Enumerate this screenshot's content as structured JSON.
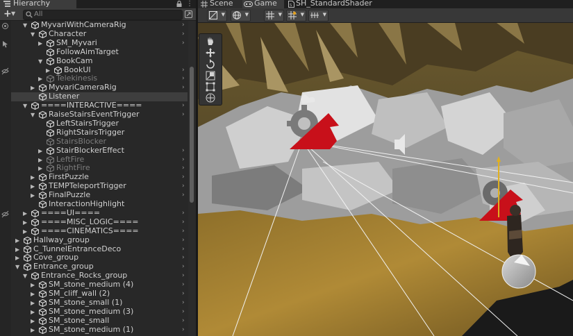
{
  "hierarchy": {
    "tab_title": "Hierarchy",
    "search_placeholder": "All",
    "rows": [
      {
        "label": "MyvariWithCameraRig",
        "indent": 1,
        "fold": "▼",
        "dim": false,
        "arrow": true
      },
      {
        "label": "Character",
        "indent": 2,
        "fold": "▼",
        "dim": false,
        "arrow": true
      },
      {
        "label": "SM_Myvari",
        "indent": 3,
        "fold": "▶",
        "dim": false,
        "arrow": true
      },
      {
        "label": "FollowAimTarget",
        "indent": 3,
        "fold": "",
        "dim": false,
        "arrow": false
      },
      {
        "label": "BookCam",
        "indent": 3,
        "fold": "▼",
        "dim": false,
        "arrow": false
      },
      {
        "label": "BookUI",
        "indent": 4,
        "fold": "▶",
        "dim": false,
        "arrow": true
      },
      {
        "label": "Telekinesis",
        "indent": 3,
        "fold": "▶",
        "dim": true,
        "arrow": true
      },
      {
        "label": "MyvariCameraRig",
        "indent": 2,
        "fold": "▶",
        "dim": false,
        "arrow": true
      },
      {
        "label": "Listener",
        "indent": 2,
        "fold": "",
        "dim": false,
        "arrow": false,
        "selected": true
      },
      {
        "label": "====INTERACTIVE====",
        "indent": 1,
        "fold": "▼",
        "dim": false,
        "arrow": true
      },
      {
        "label": "RaiseStairsEventTrigger",
        "indent": 2,
        "fold": "▼",
        "dim": false,
        "arrow": true
      },
      {
        "label": "LeftStairsTrigger",
        "indent": 3,
        "fold": "",
        "dim": false,
        "arrow": false
      },
      {
        "label": "RightStairsTrigger",
        "indent": 3,
        "fold": "",
        "dim": false,
        "arrow": false
      },
      {
        "label": "StairsBlocker",
        "indent": 3,
        "fold": "",
        "dim": true,
        "arrow": false
      },
      {
        "label": "StairBlockerEffect",
        "indent": 3,
        "fold": "▶",
        "dim": false,
        "arrow": true
      },
      {
        "label": "LeftFire",
        "indent": 3,
        "fold": "▶",
        "dim": true,
        "arrow": true
      },
      {
        "label": "RightFire",
        "indent": 3,
        "fold": "▶",
        "dim": true,
        "arrow": true
      },
      {
        "label": "FirstPuzzle",
        "indent": 2,
        "fold": "▶",
        "dim": false,
        "arrow": true
      },
      {
        "label": "TEMPTeleportTrigger",
        "indent": 2,
        "fold": "▶",
        "dim": false,
        "arrow": true
      },
      {
        "label": "FinalPuzzle",
        "indent": 2,
        "fold": "▶",
        "dim": false,
        "arrow": true
      },
      {
        "label": "InteractionHighlight",
        "indent": 2,
        "fold": "",
        "dim": false,
        "arrow": false
      },
      {
        "label": "====UI====",
        "indent": 1,
        "fold": "▶",
        "dim": false,
        "arrow": true
      },
      {
        "label": "====MISC_LOGIC====",
        "indent": 1,
        "fold": "▶",
        "dim": false,
        "arrow": true
      },
      {
        "label": "====CINEMATICS====",
        "indent": 1,
        "fold": "▶",
        "dim": false,
        "arrow": true
      },
      {
        "label": "Hallway_group",
        "indent": 0,
        "fold": "▶",
        "dim": false,
        "arrow": true
      },
      {
        "label": "C_TunnelEntranceDeco",
        "indent": 0,
        "fold": "▶",
        "dim": false,
        "arrow": true
      },
      {
        "label": "Cove_group",
        "indent": 0,
        "fold": "▶",
        "dim": false,
        "arrow": true
      },
      {
        "label": "Entrance_group",
        "indent": 0,
        "fold": "▼",
        "dim": false,
        "arrow": true
      },
      {
        "label": "Entrance_Rocks_group",
        "indent": 1,
        "fold": "▼",
        "dim": false,
        "arrow": true
      },
      {
        "label": "SM_stone_medium (4)",
        "indent": 2,
        "fold": "▶",
        "dim": false,
        "arrow": true
      },
      {
        "label": "SM_cliff_wall (2)",
        "indent": 2,
        "fold": "▶",
        "dim": false,
        "arrow": true
      },
      {
        "label": "SM_stone_small (1)",
        "indent": 2,
        "fold": "▶",
        "dim": false,
        "arrow": true
      },
      {
        "label": "SM_stone_medium (3)",
        "indent": 2,
        "fold": "▶",
        "dim": false,
        "arrow": true
      },
      {
        "label": "SM_stone_small",
        "indent": 2,
        "fold": "▶",
        "dim": false,
        "arrow": true
      },
      {
        "label": "SM_stone_medium (1)",
        "indent": 2,
        "fold": "▶",
        "dim": false,
        "arrow": true
      }
    ]
  },
  "scene_tabs": {
    "scene": "Scene",
    "game": "Game",
    "shader": "SH_StandardShader"
  },
  "icons": {
    "hierarchy_tab": "list-icon",
    "lock": "lock-icon",
    "menu": "kebab-menu-icon",
    "add": "plus-icon",
    "search": "search-icon",
    "settings": "settings-icon",
    "scene_tab": "grid-icon",
    "game_tab": "gamepad-icon",
    "shader_tab": "shader-file-icon",
    "tools": [
      "hand-tool-icon",
      "move-tool-icon",
      "rotate-tool-icon",
      "scale-tool-icon",
      "rect-tool-icon",
      "transform-tool-icon"
    ]
  },
  "colors": {
    "panel_bg": "#282828",
    "selection": "#3e3e3e",
    "gizmo_red": "#c8101a",
    "sand": "#a08030"
  }
}
